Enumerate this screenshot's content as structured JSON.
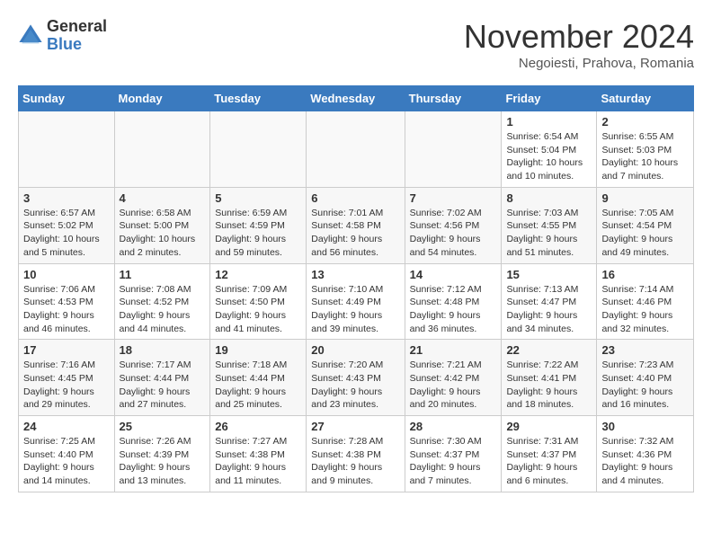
{
  "logo": {
    "general": "General",
    "blue": "Blue"
  },
  "title": "November 2024",
  "subtitle": "Negoiesti, Prahova, Romania",
  "days_of_week": [
    "Sunday",
    "Monday",
    "Tuesday",
    "Wednesday",
    "Thursday",
    "Friday",
    "Saturday"
  ],
  "weeks": [
    [
      {
        "num": "",
        "info": ""
      },
      {
        "num": "",
        "info": ""
      },
      {
        "num": "",
        "info": ""
      },
      {
        "num": "",
        "info": ""
      },
      {
        "num": "",
        "info": ""
      },
      {
        "num": "1",
        "info": "Sunrise: 6:54 AM\nSunset: 5:04 PM\nDaylight: 10 hours and 10 minutes."
      },
      {
        "num": "2",
        "info": "Sunrise: 6:55 AM\nSunset: 5:03 PM\nDaylight: 10 hours and 7 minutes."
      }
    ],
    [
      {
        "num": "3",
        "info": "Sunrise: 6:57 AM\nSunset: 5:02 PM\nDaylight: 10 hours and 5 minutes."
      },
      {
        "num": "4",
        "info": "Sunrise: 6:58 AM\nSunset: 5:00 PM\nDaylight: 10 hours and 2 minutes."
      },
      {
        "num": "5",
        "info": "Sunrise: 6:59 AM\nSunset: 4:59 PM\nDaylight: 9 hours and 59 minutes."
      },
      {
        "num": "6",
        "info": "Sunrise: 7:01 AM\nSunset: 4:58 PM\nDaylight: 9 hours and 56 minutes."
      },
      {
        "num": "7",
        "info": "Sunrise: 7:02 AM\nSunset: 4:56 PM\nDaylight: 9 hours and 54 minutes."
      },
      {
        "num": "8",
        "info": "Sunrise: 7:03 AM\nSunset: 4:55 PM\nDaylight: 9 hours and 51 minutes."
      },
      {
        "num": "9",
        "info": "Sunrise: 7:05 AM\nSunset: 4:54 PM\nDaylight: 9 hours and 49 minutes."
      }
    ],
    [
      {
        "num": "10",
        "info": "Sunrise: 7:06 AM\nSunset: 4:53 PM\nDaylight: 9 hours and 46 minutes."
      },
      {
        "num": "11",
        "info": "Sunrise: 7:08 AM\nSunset: 4:52 PM\nDaylight: 9 hours and 44 minutes."
      },
      {
        "num": "12",
        "info": "Sunrise: 7:09 AM\nSunset: 4:50 PM\nDaylight: 9 hours and 41 minutes."
      },
      {
        "num": "13",
        "info": "Sunrise: 7:10 AM\nSunset: 4:49 PM\nDaylight: 9 hours and 39 minutes."
      },
      {
        "num": "14",
        "info": "Sunrise: 7:12 AM\nSunset: 4:48 PM\nDaylight: 9 hours and 36 minutes."
      },
      {
        "num": "15",
        "info": "Sunrise: 7:13 AM\nSunset: 4:47 PM\nDaylight: 9 hours and 34 minutes."
      },
      {
        "num": "16",
        "info": "Sunrise: 7:14 AM\nSunset: 4:46 PM\nDaylight: 9 hours and 32 minutes."
      }
    ],
    [
      {
        "num": "17",
        "info": "Sunrise: 7:16 AM\nSunset: 4:45 PM\nDaylight: 9 hours and 29 minutes."
      },
      {
        "num": "18",
        "info": "Sunrise: 7:17 AM\nSunset: 4:44 PM\nDaylight: 9 hours and 27 minutes."
      },
      {
        "num": "19",
        "info": "Sunrise: 7:18 AM\nSunset: 4:44 PM\nDaylight: 9 hours and 25 minutes."
      },
      {
        "num": "20",
        "info": "Sunrise: 7:20 AM\nSunset: 4:43 PM\nDaylight: 9 hours and 23 minutes."
      },
      {
        "num": "21",
        "info": "Sunrise: 7:21 AM\nSunset: 4:42 PM\nDaylight: 9 hours and 20 minutes."
      },
      {
        "num": "22",
        "info": "Sunrise: 7:22 AM\nSunset: 4:41 PM\nDaylight: 9 hours and 18 minutes."
      },
      {
        "num": "23",
        "info": "Sunrise: 7:23 AM\nSunset: 4:40 PM\nDaylight: 9 hours and 16 minutes."
      }
    ],
    [
      {
        "num": "24",
        "info": "Sunrise: 7:25 AM\nSunset: 4:40 PM\nDaylight: 9 hours and 14 minutes."
      },
      {
        "num": "25",
        "info": "Sunrise: 7:26 AM\nSunset: 4:39 PM\nDaylight: 9 hours and 13 minutes."
      },
      {
        "num": "26",
        "info": "Sunrise: 7:27 AM\nSunset: 4:38 PM\nDaylight: 9 hours and 11 minutes."
      },
      {
        "num": "27",
        "info": "Sunrise: 7:28 AM\nSunset: 4:38 PM\nDaylight: 9 hours and 9 minutes."
      },
      {
        "num": "28",
        "info": "Sunrise: 7:30 AM\nSunset: 4:37 PM\nDaylight: 9 hours and 7 minutes."
      },
      {
        "num": "29",
        "info": "Sunrise: 7:31 AM\nSunset: 4:37 PM\nDaylight: 9 hours and 6 minutes."
      },
      {
        "num": "30",
        "info": "Sunrise: 7:32 AM\nSunset: 4:36 PM\nDaylight: 9 hours and 4 minutes."
      }
    ]
  ]
}
